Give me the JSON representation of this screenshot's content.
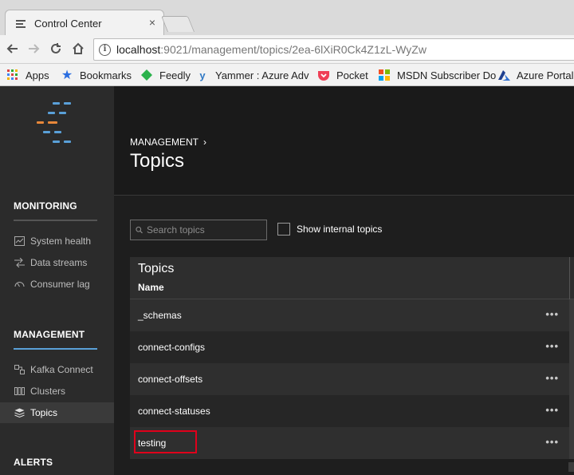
{
  "browser": {
    "tab_title": "Control Center",
    "tab_close": "×",
    "url_host": "localhost",
    "url_rest": ":9021/management/topics/2ea-6lXiR0Ck4Z1zL-WyZw",
    "bookmarks": [
      {
        "label": "Apps",
        "icon": "apps-grid-icon"
      },
      {
        "label": "Bookmarks",
        "icon": "star-icon"
      },
      {
        "label": "Feedly",
        "icon": "feedly-icon"
      },
      {
        "label": "Yammer : Azure Adv",
        "icon": "yammer-icon"
      },
      {
        "label": "Pocket",
        "icon": "pocket-icon"
      },
      {
        "label": "MSDN Subscriber Do",
        "icon": "windows-logo-icon"
      },
      {
        "label": "Azure Portal",
        "icon": "azure-icon"
      }
    ]
  },
  "sidebar": {
    "monitoring": {
      "title": "MONITORING",
      "items": [
        {
          "label": "System health",
          "icon": "system-health-icon"
        },
        {
          "label": "Data streams",
          "icon": "data-streams-icon"
        },
        {
          "label": "Consumer lag",
          "icon": "consumer-lag-icon"
        }
      ]
    },
    "management": {
      "title": "MANAGEMENT",
      "items": [
        {
          "label": "Kafka Connect",
          "icon": "kafka-connect-icon"
        },
        {
          "label": "Clusters",
          "icon": "clusters-icon"
        },
        {
          "label": "Topics",
          "icon": "topics-icon",
          "active": true
        }
      ]
    },
    "alerts": {
      "title": "ALERTS"
    }
  },
  "header": {
    "breadcrumb": "MANAGEMENT",
    "title": "Topics"
  },
  "filters": {
    "search_placeholder": "Search topics",
    "show_internal_label": "Show internal topics",
    "show_internal_checked": false
  },
  "table": {
    "title": "Topics",
    "column": "Name",
    "row_menu": "•••",
    "rows": [
      "_schemas",
      "connect-configs",
      "connect-offsets",
      "connect-statuses",
      "testing"
    ],
    "highlighted_row": "testing"
  },
  "colors": {
    "accent_blue": "#5aa0d8",
    "accent_orange": "#e8883a",
    "highlight_red": "#e0001b"
  }
}
